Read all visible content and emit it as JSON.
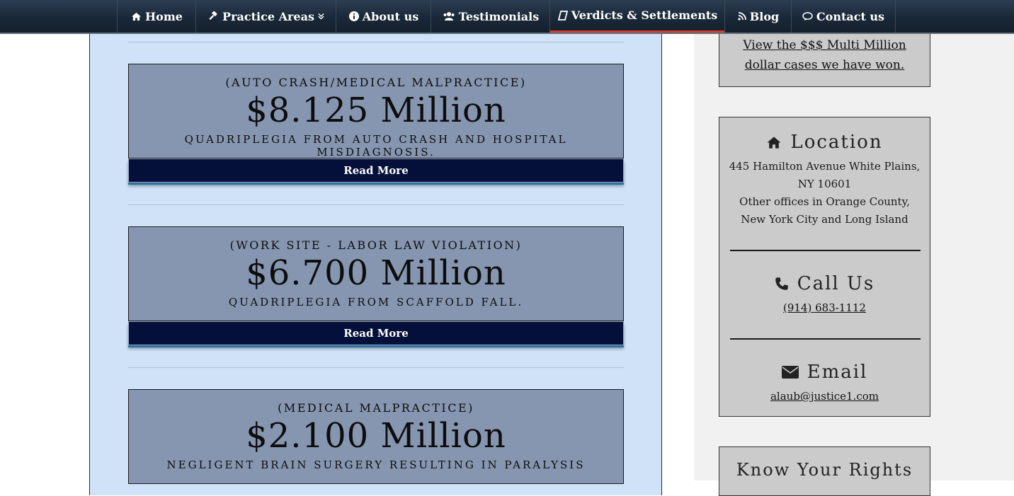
{
  "nav": {
    "items": [
      {
        "label": "Home",
        "icon": "home-icon"
      },
      {
        "label": "Practice Areas",
        "icon": "gavel-icon",
        "has_caret": true
      },
      {
        "label": "About us",
        "icon": "info-icon"
      },
      {
        "label": "Testimonials",
        "icon": "users-icon"
      },
      {
        "label": "Verdicts & Settlements",
        "icon": "book-icon",
        "active": true
      },
      {
        "label": "Blog",
        "icon": "rss-icon"
      },
      {
        "label": "Contact us",
        "icon": "comments-icon"
      }
    ]
  },
  "verdicts": [
    {
      "category": "(AUTO CRASH/MEDICAL MALPRACTICE)",
      "amount": "$8.125 Million",
      "description": "QUADRIPLEGIA FROM AUTO CRASH AND HOSPITAL MISDIAGNOSIS.",
      "button": "Read More"
    },
    {
      "category": "(WORK SITE - LABOR LAW VIOLATION)",
      "amount": "$6.700 Million",
      "description": "QUADRIPLEGIA FROM SCAFFOLD FALL.",
      "button": "Read More"
    },
    {
      "category": "(MEDICAL MALPRACTICE)",
      "amount": "$2.100 Million",
      "description": "NEGLIGENT BRAIN SURGERY RESULTING IN PARALYSIS"
    }
  ],
  "sidebar": {
    "verdict_link": "View the $$$ Multi Million dollar cases we have won.",
    "location": {
      "heading": "Location",
      "icon": "home-icon",
      "address": "445 Hamilton Avenue White Plains, NY 10601",
      "other_offices": "Other offices in Orange County, New York City and Long Island"
    },
    "call": {
      "heading": "Call Us",
      "icon": "phone-icon",
      "phone": "(914) 683-1112"
    },
    "email": {
      "heading": "Email",
      "icon": "envelope-icon",
      "address": "alaub@justice1.com"
    },
    "rights": {
      "heading": "Know Your Rights"
    }
  },
  "colors": {
    "nav_bg": "#1a2838",
    "active_underline": "#d23b2e",
    "main_bg": "#cfe2f7",
    "card_bg": "#8696b0",
    "button_bg": "#04103a",
    "sidebar_bg": "#f1f1f1",
    "sidebar_box_bg": "#cbcbcb"
  }
}
